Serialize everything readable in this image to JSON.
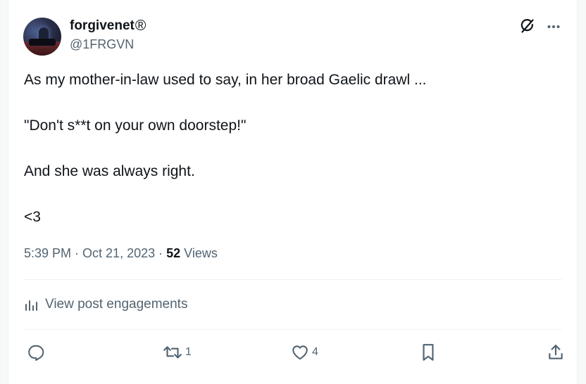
{
  "author": {
    "display_name": "forgivenet",
    "registered_mark": "®",
    "handle": "@1FRGVN"
  },
  "header_icons": {
    "grok": "grok-icon",
    "more": "more-icon"
  },
  "tweet": {
    "lines": [
      "As my mother-in-law used to say, in her broad Gaelic drawl ...",
      "\"Don't s**t on your own doorstep!\"",
      "And she was always right.",
      "<3"
    ]
  },
  "meta": {
    "time": "5:39 PM",
    "separator": "·",
    "date": "Oct 21, 2023",
    "views_count": "52",
    "views_label": "Views"
  },
  "engagements": {
    "label": "View post engagements",
    "icon": "analytics-icon"
  },
  "actions": {
    "reply": {
      "icon": "reply-icon"
    },
    "repost": {
      "icon": "repost-icon",
      "count": "1"
    },
    "like": {
      "icon": "heart-icon",
      "count": "4"
    },
    "bookmark": {
      "icon": "bookmark-icon"
    },
    "share": {
      "icon": "share-icon"
    }
  },
  "colors": {
    "text_primary": "#0f1419",
    "text_secondary": "#536471",
    "divider": "#eff3f4"
  }
}
